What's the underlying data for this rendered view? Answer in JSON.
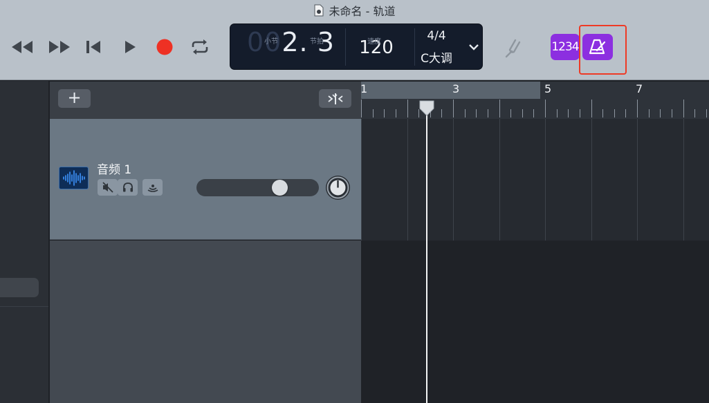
{
  "window": {
    "title": "未命名 - 轨道"
  },
  "toolbar": {
    "transport": {
      "rewind_icon": "rewind-icon",
      "fast_forward_icon": "fast-forward-icon",
      "go_to_start_icon": "skip-to-start-icon",
      "play_icon": "play-icon",
      "record_icon": "record-icon",
      "cycle_icon": "cycle-loop-icon"
    },
    "lcd": {
      "position_dim": "00",
      "position_value": "2. 3",
      "bar_label": "小节",
      "beat_label": "节拍",
      "tempo": "120",
      "tempo_label": "速度",
      "time_signature": "4/4",
      "key": "C大调"
    },
    "count_in_label": "1234",
    "colors": {
      "accent_purple": "#8c2fe0",
      "record_red": "#ee3124",
      "highlight_red": "#ee3a25",
      "selection_blue": "#3b9be6"
    }
  },
  "tracks": {
    "add_label": "+",
    "items": [
      {
        "name": "音频 1",
        "volume": 0.72
      }
    ]
  },
  "ruler": {
    "bars": [
      "1",
      "3",
      "5",
      "7"
    ],
    "playhead_beat": "2.3"
  }
}
